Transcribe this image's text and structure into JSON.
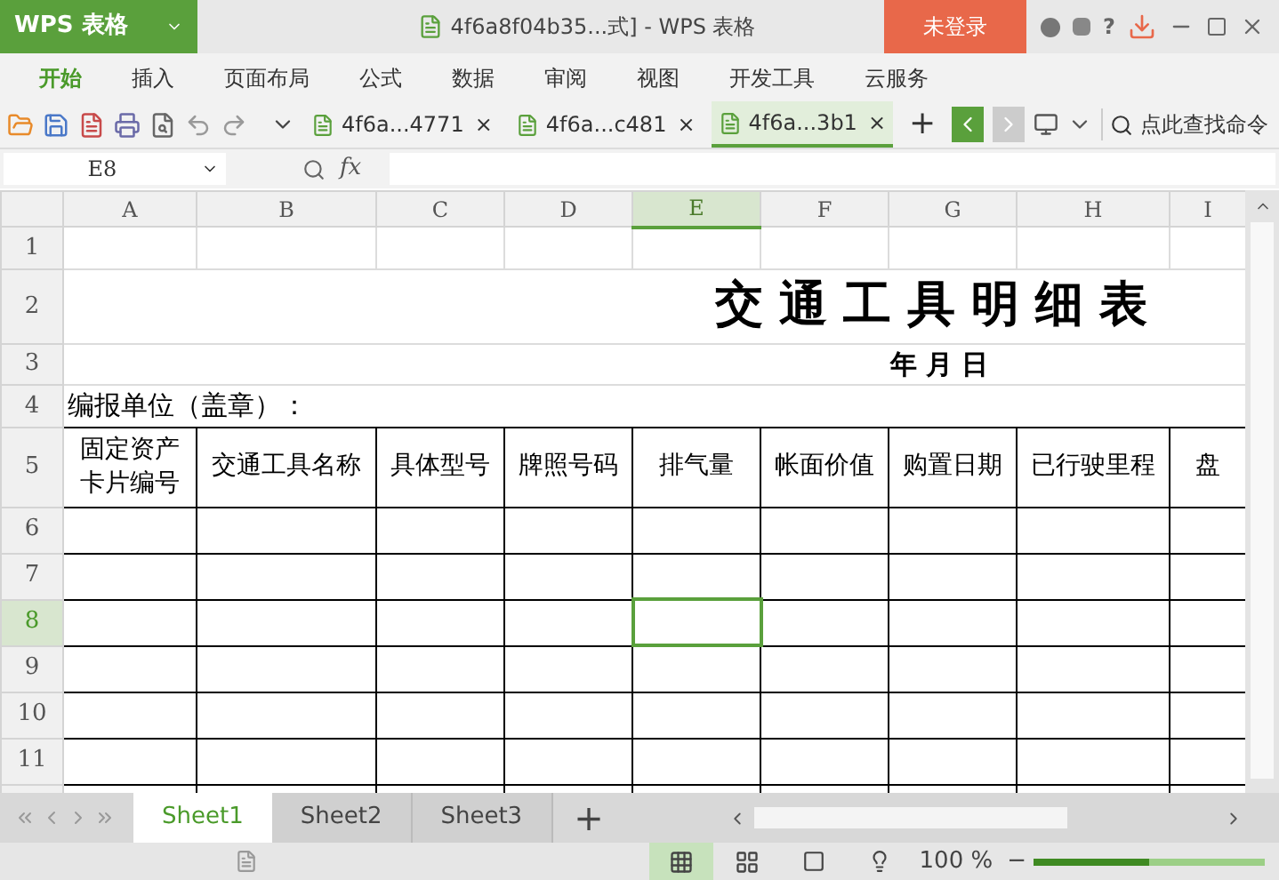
{
  "title_bar": {
    "app_menu": "WPS 表格",
    "document_title": "4f6a8f04b35...式] - WPS 表格",
    "login_button": "未登录",
    "help": "?"
  },
  "ribbon_tabs": [
    {
      "label": "开始",
      "selected": true
    },
    {
      "label": "插入",
      "selected": false
    },
    {
      "label": "页面布局",
      "selected": false
    },
    {
      "label": "公式",
      "selected": false
    },
    {
      "label": "数据",
      "selected": false
    },
    {
      "label": "审阅",
      "selected": false
    },
    {
      "label": "视图",
      "selected": false
    },
    {
      "label": "开发工具",
      "selected": false
    },
    {
      "label": "云服务",
      "selected": false
    }
  ],
  "document_tabs": [
    {
      "label": "4f6a...4771",
      "close": "×",
      "selected": false
    },
    {
      "label": "4f6a...c481",
      "close": "×",
      "selected": false
    },
    {
      "label": "4f6a...3b1",
      "close": "×",
      "selected": true
    }
  ],
  "new_tab": "+",
  "command_search": "点此查找命令",
  "formula_bar": {
    "name_box": "E8",
    "fx": "fx"
  },
  "sheet": {
    "columns": [
      {
        "label": "A",
        "selected": false
      },
      {
        "label": "B",
        "selected": false
      },
      {
        "label": "C",
        "selected": false
      },
      {
        "label": "D",
        "selected": false
      },
      {
        "label": "E",
        "selected": true
      },
      {
        "label": "F",
        "selected": false
      },
      {
        "label": "G",
        "selected": false
      },
      {
        "label": "H",
        "selected": false
      },
      {
        "label": "I",
        "selected": false
      }
    ],
    "rows": [
      {
        "number": "1",
        "kind": "blank",
        "selected": false
      },
      {
        "number": "2",
        "kind": "title",
        "text": "交通工具明细表",
        "selected": false
      },
      {
        "number": "3",
        "kind": "date",
        "text": "年 月 日",
        "selected": false
      },
      {
        "number": "4",
        "kind": "unit",
        "text": "编报单位（盖章）：",
        "selected": false
      },
      {
        "number": "5",
        "kind": "header",
        "cells": [
          "固定资产卡片编号",
          "交通工具名称",
          "具体型号",
          "牌照号码",
          "排气量",
          "帐面价值",
          "购置日期",
          "已行驶里程",
          "盘"
        ],
        "selected": false
      },
      {
        "number": "6",
        "kind": "grid",
        "selected": false
      },
      {
        "number": "7",
        "kind": "grid",
        "selected": false
      },
      {
        "number": "8",
        "kind": "grid",
        "selected": true
      },
      {
        "number": "9",
        "kind": "grid",
        "selected": false
      },
      {
        "number": "10",
        "kind": "grid",
        "selected": false
      },
      {
        "number": "11",
        "kind": "grid",
        "selected": false
      }
    ]
  },
  "sheet_tabs": [
    {
      "label": "Sheet1",
      "selected": true
    },
    {
      "label": "Sheet2",
      "selected": false
    },
    {
      "label": "Sheet3",
      "selected": false
    }
  ],
  "add_sheet": "+",
  "status_bar": {
    "zoom": "100 %",
    "zoom_out": "−",
    "zoom_slider": {
      "level": 0.5
    }
  }
}
